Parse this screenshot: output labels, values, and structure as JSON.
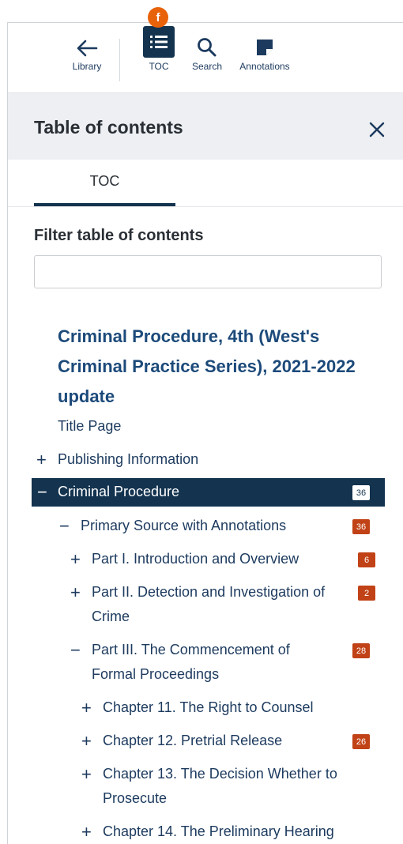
{
  "marker": "f",
  "toolbar": {
    "library": "Library",
    "toc": "TOC",
    "search": "Search",
    "annotations": "Annotations"
  },
  "header": {
    "title": "Table of contents"
  },
  "tabs": [
    {
      "label": "TOC"
    }
  ],
  "filter": {
    "label": "Filter table of contents",
    "placeholder": ""
  },
  "toc": {
    "book_title": "Criminal Procedure, 4th (West's Criminal Practice Series), 2021-2022 update",
    "items": [
      {
        "label": "Title Page",
        "sign": "",
        "badge": ""
      },
      {
        "label": "Publishing Information",
        "sign": "+",
        "badge": ""
      },
      {
        "label": "Criminal Procedure",
        "sign": "−",
        "badge": "36"
      },
      {
        "label": "Primary Source with Annotations",
        "sign": "−",
        "badge": "36"
      },
      {
        "label": "Part I. Introduction and Overview",
        "sign": "+",
        "badge": "6"
      },
      {
        "label": "Part II. Detection and Investigation of Crime",
        "sign": "+",
        "badge": "2"
      },
      {
        "label": "Part III. The Commencement of Formal Proceedings",
        "sign": "−",
        "badge": "28"
      },
      {
        "label": "Chapter 11. The Right to Counsel",
        "sign": "+",
        "badge": ""
      },
      {
        "label": "Chapter 12. Pretrial Release",
        "sign": "+",
        "badge": "26"
      },
      {
        "label": "Chapter 13. The Decision Whether to Prosecute",
        "sign": "+",
        "badge": ""
      },
      {
        "label": "Chapter 14. The Preliminary Hearing",
        "sign": "+",
        "badge": ""
      }
    ]
  },
  "colors": {
    "navy": "#13334f",
    "link": "#1c3a5e",
    "badge": "#c14216",
    "marker": "#e8620a"
  }
}
